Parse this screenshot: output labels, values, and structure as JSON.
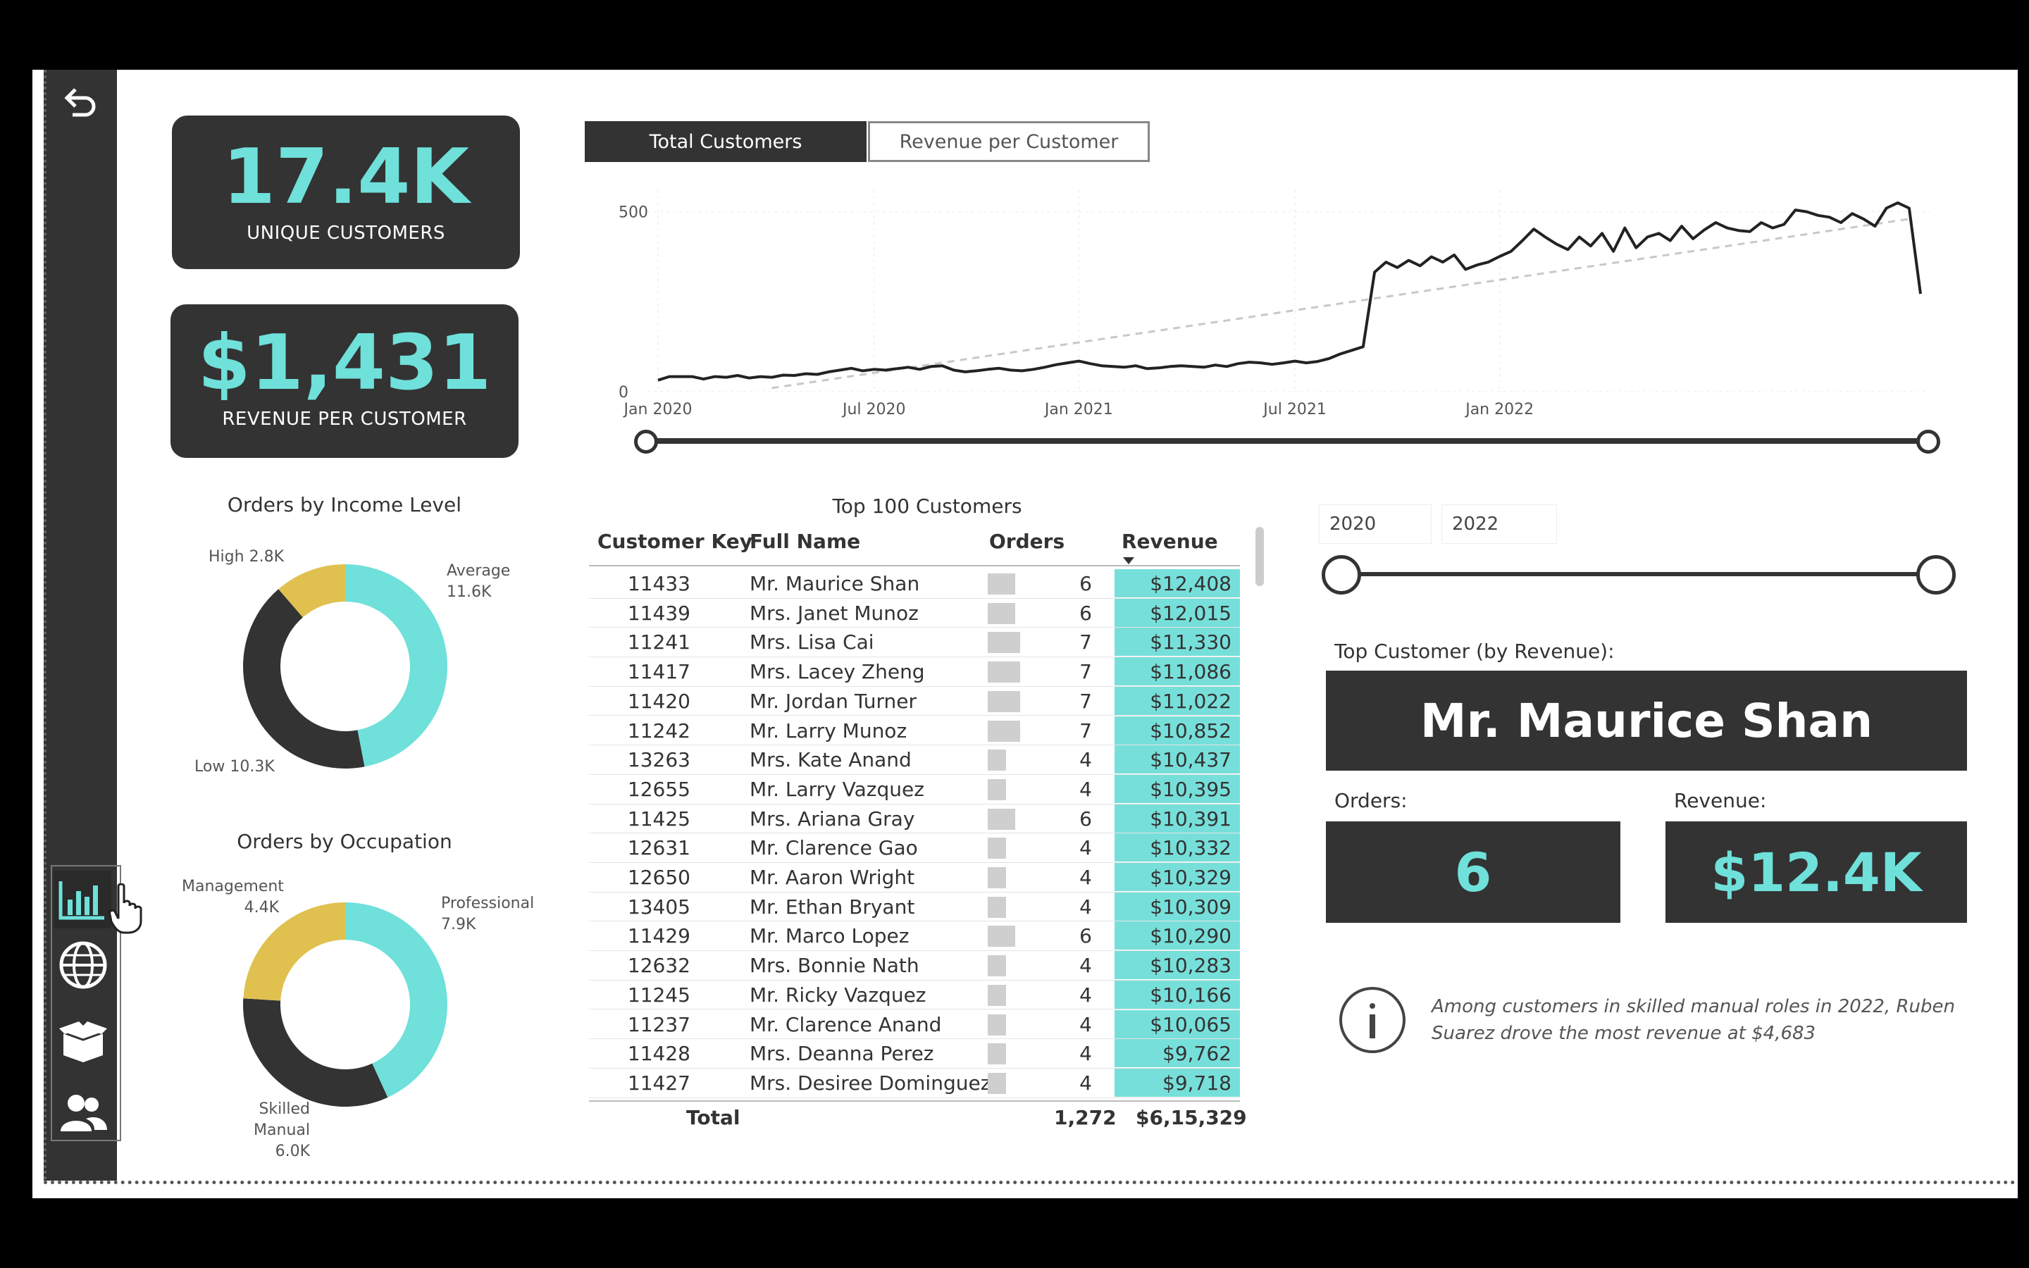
{
  "nav": {
    "back_icon": "back-arrow-icon",
    "items": [
      "bar-chart-icon",
      "globe-icon",
      "box-icon",
      "users-icon"
    ]
  },
  "kpis": {
    "unique_customers": {
      "value": "17.4K",
      "label": "UNIQUE CUSTOMERS"
    },
    "revenue_per_customer": {
      "value": "$1,431",
      "label": "REVENUE PER CUSTOMER"
    }
  },
  "tabs": {
    "active": "Total Customers",
    "inactive": "Revenue per Customer"
  },
  "chart_data": [
    {
      "type": "line",
      "ylim": [
        0,
        560
      ],
      "yticks": [
        "0",
        "500"
      ],
      "xticks": [
        "Jan 2020",
        "Jul 2020",
        "Jan 2021",
        "Jul 2021",
        "Jan 2022"
      ],
      "series": [
        {
          "values": [
            32,
            42,
            42,
            42,
            35,
            42,
            40,
            45,
            38,
            42,
            40,
            46,
            45,
            50,
            48,
            55,
            60,
            65,
            58,
            62,
            60,
            64,
            68,
            62,
            70,
            72,
            60,
            55,
            58,
            62,
            65,
            60,
            58,
            62,
            68,
            75,
            80,
            85,
            78,
            72,
            70,
            68,
            72,
            64,
            66,
            70,
            72,
            70,
            68,
            74,
            70,
            78,
            82,
            80,
            76,
            80,
            85,
            80,
            84,
            92,
            105,
            115,
            125,
            332,
            360,
            345,
            365,
            350,
            375,
            360,
            380,
            340,
            352,
            360,
            376,
            390,
            420,
            452,
            430,
            410,
            395,
            430,
            405,
            440,
            390,
            455,
            400,
            430,
            440,
            420,
            460,
            425,
            450,
            470,
            455,
            448,
            445,
            470,
            455,
            465,
            505,
            500,
            490,
            485,
            470,
            495,
            480,
            460,
            510,
            525,
            510,
            272
          ]
        },
        {
          "dashed": true,
          "values": [
            10,
            480
          ]
        }
      ]
    },
    {
      "type": "pie",
      "title": "Orders by Income Level",
      "labels": [
        "Average",
        "Low",
        "High"
      ],
      "values": [
        11.6,
        10.3,
        2.8
      ],
      "display": [
        "11.6K",
        "10.3K",
        "2.8K"
      ],
      "colors": [
        "#6fe0da",
        "#333333",
        "#e0c14f"
      ]
    },
    {
      "type": "pie",
      "title": "Orders by Occupation",
      "labels": [
        "Professional",
        "Skilled Manual",
        "Management"
      ],
      "values": [
        7.9,
        6.0,
        4.4
      ],
      "display": [
        "7.9K",
        "6.0K",
        "4.4K"
      ],
      "colors": [
        "#6fe0da",
        "#333333",
        "#e0c14f"
      ]
    }
  ],
  "table": {
    "title": "Top 100 Customers",
    "headers": [
      "Customer Key",
      "Full Name",
      "Orders",
      "Revenue"
    ],
    "rows": [
      {
        "key": "11433",
        "name": "Mr. Maurice Shan",
        "orders": 6,
        "revenue": "$12,408"
      },
      {
        "key": "11439",
        "name": "Mrs. Janet Munoz",
        "orders": 6,
        "revenue": "$12,015"
      },
      {
        "key": "11241",
        "name": "Mrs. Lisa Cai",
        "orders": 7,
        "revenue": "$11,330"
      },
      {
        "key": "11417",
        "name": "Mrs. Lacey Zheng",
        "orders": 7,
        "revenue": "$11,086"
      },
      {
        "key": "11420",
        "name": "Mr. Jordan Turner",
        "orders": 7,
        "revenue": "$11,022"
      },
      {
        "key": "11242",
        "name": "Mr. Larry Munoz",
        "orders": 7,
        "revenue": "$10,852"
      },
      {
        "key": "13263",
        "name": "Mrs. Kate Anand",
        "orders": 4,
        "revenue": "$10,437"
      },
      {
        "key": "12655",
        "name": "Mr. Larry Vazquez",
        "orders": 4,
        "revenue": "$10,395"
      },
      {
        "key": "11425",
        "name": "Mrs. Ariana Gray",
        "orders": 6,
        "revenue": "$10,391"
      },
      {
        "key": "12631",
        "name": "Mr. Clarence Gao",
        "orders": 4,
        "revenue": "$10,332"
      },
      {
        "key": "12650",
        "name": "Mr. Aaron Wright",
        "orders": 4,
        "revenue": "$10,329"
      },
      {
        "key": "13405",
        "name": "Mr. Ethan Bryant",
        "orders": 4,
        "revenue": "$10,309"
      },
      {
        "key": "11429",
        "name": "Mr. Marco Lopez",
        "orders": 6,
        "revenue": "$10,290"
      },
      {
        "key": "12632",
        "name": "Mrs. Bonnie Nath",
        "orders": 4,
        "revenue": "$10,283"
      },
      {
        "key": "11245",
        "name": "Mr. Ricky Vazquez",
        "orders": 4,
        "revenue": "$10,166"
      },
      {
        "key": "11237",
        "name": "Mr. Clarence Anand",
        "orders": 4,
        "revenue": "$10,065"
      },
      {
        "key": "11428",
        "name": "Mrs. Deanna Perez",
        "orders": 4,
        "revenue": "$9,762"
      },
      {
        "key": "11427",
        "name": "Mrs. Desiree Dominguez",
        "orders": 4,
        "revenue": "$9,718"
      }
    ],
    "total_label": "Total",
    "total_orders": "1,272",
    "total_revenue": "$6,15,329"
  },
  "year_filter": {
    "start": "2020",
    "end": "2022"
  },
  "top_customer": {
    "label": "Top Customer (by Revenue):",
    "name": "Mr. Maurice Shan",
    "orders_label": "Orders:",
    "orders_value": "6",
    "revenue_label": "Revenue:",
    "revenue_value": "$12.4K"
  },
  "insight": {
    "icon": "info-icon",
    "text_line1": "Among customers in skilled manual roles in 2022, Ruben",
    "text_line2": "Suarez drove the most revenue at $4,683"
  },
  "colors": {
    "accent": "#6fe0da",
    "dark": "#333333",
    "gold": "#e0c14f"
  }
}
